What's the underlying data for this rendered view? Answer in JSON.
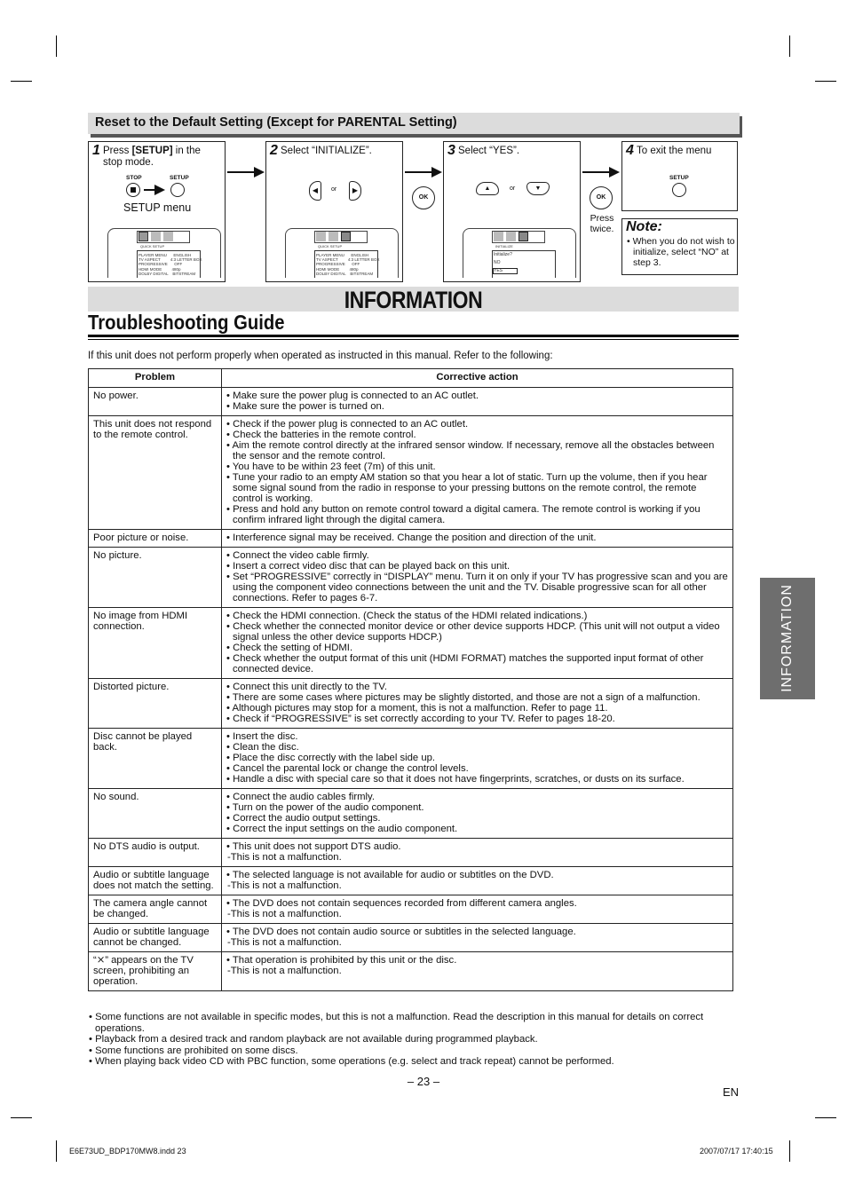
{
  "reset_section": {
    "title": "Reset to the Default Setting (Except for PARENTAL Setting)",
    "steps": [
      {
        "num": "1",
        "text_prefix": "Press ",
        "text_bold": "[SETUP]",
        "text_suffix": " in the stop mode.",
        "buttons": [
          "STOP",
          "SETUP"
        ],
        "caption": "SETUP menu",
        "screen": {
          "tab": "QUICK SETUP",
          "rows": [
            "PLAYER MENU      ENGLISH",
            "TV ASPECT         4:3 LETTER BOX",
            "PROGRESSIVE      OFF",
            "HDMI MODE         480p",
            "DOLBY DIGITAL    BITSTREAM"
          ]
        }
      },
      {
        "num": "2",
        "text": "Select “INITIALIZE”.",
        "or": "or",
        "screen": {
          "tab": "QUICK SETUP",
          "rows": [
            "PLAYER MENU      ENGLISH",
            "TV ASPECT         4:3 LETTER BOX",
            "PROGRESSIVE      OFF",
            "HDMI MODE         480p",
            "DOLBY DIGITAL    BITSTREAM"
          ]
        }
      },
      {
        "num": "3",
        "text": "Select “YES”.",
        "or": "or",
        "screen": {
          "tab": "INITIALIZE",
          "rows": [
            "Initialize?",
            "NO",
            "YES"
          ]
        }
      },
      {
        "num": "4",
        "text": "To exit the menu",
        "buttons": [
          "SETUP"
        ]
      }
    ],
    "ok_label": "OK",
    "press_twice": "Press twice.",
    "note": {
      "title": "Note:",
      "text": "When you do not wish to initialize, select “NO” at step 3."
    }
  },
  "section_banner": "INFORMATION",
  "page_title": "Troubleshooting Guide",
  "intro": "If this unit does not perform properly when operated as instructed in this manual. Refer to the following:",
  "table": {
    "headers": [
      "Problem",
      "Corrective action"
    ],
    "rows": [
      {
        "problem": "No power.",
        "actions": [
          "Make sure the power plug is connected to an AC outlet.",
          "Make sure the power is turned on."
        ]
      },
      {
        "problem": "This unit does not respond to the remote control.",
        "actions": [
          "Check if the power plug is connected to an AC outlet.",
          "Check the batteries in the remote control.",
          "Aim the remote control directly at the infrared sensor window. If necessary, remove all the obstacles between the sensor and the remote control.",
          "You have to be within 23 feet (7m) of this unit.",
          "Tune your radio to an empty AM station so that you hear a lot of static. Turn up the volume, then if you hear some signal sound from the radio in response to your pressing buttons on the remote control, the remote control is working.",
          "Press and hold any button on remote control toward a digital camera. The remote control is working if you confirm infrared light through the digital camera."
        ]
      },
      {
        "problem": "Poor picture or noise.",
        "actions": [
          "Interference signal may be received. Change the position and direction of the unit."
        ]
      },
      {
        "problem": "No picture.",
        "actions": [
          "Connect the video cable firmly.",
          "Insert a correct video disc that can be played back on this unit.",
          "Set “PROGRESSIVE” correctly in “DISPLAY” menu. Turn it on only if your TV has progressive scan and you are using the component video connections between the unit and the TV. Disable progressive scan for all other connections. Refer to pages 6-7."
        ]
      },
      {
        "problem": "No image from HDMI connection.",
        "actions": [
          "Check the HDMI connection. (Check the status of the HDMI related indications.)",
          "Check whether the connected monitor device or other device supports HDCP. (This unit will not output a video signal unless the other device supports HDCP.)",
          "Check the setting of HDMI.",
          "Check whether the output format of this unit (HDMI FORMAT) matches the supported input format of other connected device."
        ]
      },
      {
        "problem": "Distorted picture.",
        "actions": [
          "Connect this unit directly to the TV.",
          "There are some cases where pictures may be slightly distorted, and those are not a sign of a malfunction.",
          "Although pictures may stop for a moment, this is not a malfunction. Refer to page 11.",
          "Check if “PROGRESSIVE” is set correctly according to your TV. Refer to pages 18-20."
        ]
      },
      {
        "problem": "Disc cannot be played back.",
        "actions": [
          "Insert the disc.",
          "Clean the disc.",
          "Place the disc correctly with the label side up.",
          "Cancel the parental lock or change the control levels.",
          "Handle a disc with special care so that it does not have fingerprints, scratches, or dusts on its surface."
        ]
      },
      {
        "problem": "No sound.",
        "actions": [
          "Connect the audio cables firmly.",
          "Turn on the power of the audio component.",
          "Correct the audio output settings.",
          "Correct the input settings on the audio component."
        ]
      },
      {
        "problem": "No DTS audio is output.",
        "actions": [
          "This unit does not support DTS audio."
        ],
        "sub": "-This is not a malfunction."
      },
      {
        "problem": "Audio or subtitle language does not match the setting.",
        "actions": [
          "The selected language is not available for audio or subtitles on the DVD."
        ],
        "sub": "-This is not a malfunction."
      },
      {
        "problem": "The camera angle cannot be changed.",
        "actions": [
          "The DVD does not contain sequences recorded from different camera angles."
        ],
        "sub": "-This is not a malfunction."
      },
      {
        "problem": "Audio or subtitle language\ncannot be changed.",
        "actions": [
          "The DVD does not contain audio source or subtitles in the selected language."
        ],
        "sub": "-This is not a malfunction."
      },
      {
        "problem": "“⨯” appears on the TV screen, prohibiting an operation.",
        "actions": [
          "That operation is prohibited by this unit or the disc."
        ],
        "sub": "-This is not a malfunction."
      }
    ]
  },
  "notes": [
    "Some functions are not available in specific modes, but this is not a malfunction. Read the description in this manual for details on correct operations.",
    "Playback from a desired track and random playback are not available during programmed playback.",
    "Some functions are prohibited on some discs.",
    "When playing back video CD with PBC function, some operations (e.g. select and track repeat) cannot be performed."
  ],
  "page_number": "– 23 –",
  "language": "EN",
  "side_tab": "INFORMATION",
  "footer": {
    "file": "E6E73UD_BDP170MW8.indd   23",
    "timestamp": "2007/07/17   17:40:15"
  }
}
